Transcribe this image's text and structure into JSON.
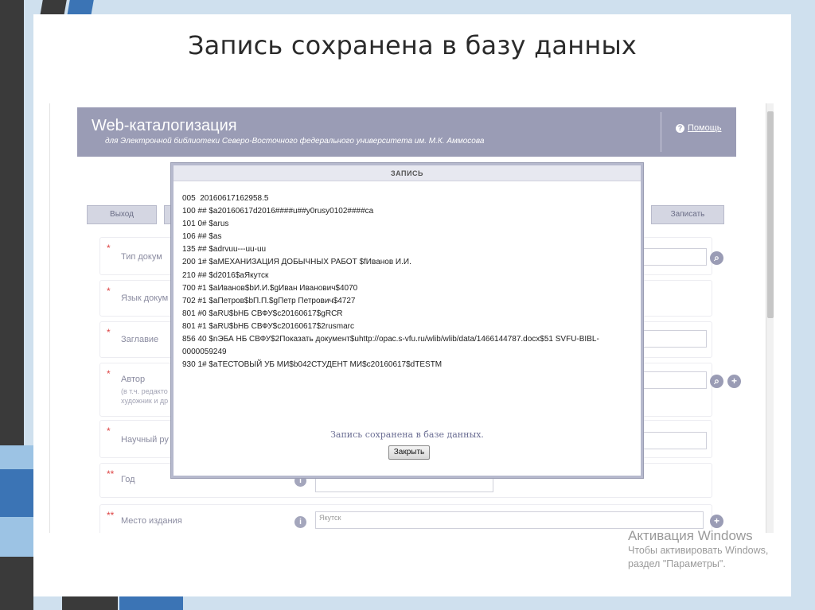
{
  "slide": {
    "title": "Запись сохранена в базу данных"
  },
  "banner": {
    "title": "Web-каталогизация",
    "subtitle": "для Электронной библиотеки Северо-Восточного федерального университета им. М.К. Аммосова",
    "help_label": "Помощь"
  },
  "toolbar": {
    "exit_label": "Выход",
    "save_label": "Записать"
  },
  "form": {
    "fields": [
      {
        "label": "Тип докум",
        "required": "*"
      },
      {
        "label": "Язык докум",
        "required": "*"
      },
      {
        "label": "Заглавие",
        "required": "*"
      },
      {
        "label": "Автор",
        "sub1": "(в т.ч. редакто",
        "sub2": "художник и др",
        "required": "*"
      },
      {
        "label": "Научный ру",
        "required": "*"
      },
      {
        "label": "Год",
        "required": "**"
      },
      {
        "label": "Место издания",
        "required": "**",
        "value": "Якутск"
      }
    ]
  },
  "dialog": {
    "title": "ЗАПИСЬ",
    "lines": [
      "005  20160617162958.5",
      "100 ## $a20160617d2016####u##y0rusy0102####ca",
      "101 0# $arus",
      "106 ## $as",
      "135 ## $adrvuu---uu-uu",
      "200 1# $aМЕХАНИЗАЦИЯ ДОБЫЧНЫХ РАБОТ $fИванов И.И.",
      "210 ## $d2016$aЯкутск",
      "700 #1 $aИванов$bИ.И.$gИван Иванович$4070",
      "702 #1 $aПетров$bП.П.$gПетр Петрович$4727",
      "801 #0 $aRU$bНБ СВФУ$c20160617$gRCR",
      "801 #1 $aRU$bНБ СВФУ$c20160617$2rusmarc",
      "856 40 $nЭБА НБ СВФУ$2Показать документ$uhttp://opac.s-vfu.ru/wlib/wlib/data/1466144787.docx$51 SVFU-BIBL-0000059249",
      "930 1# $aТЕСТОВЫЙ УБ МИ$b042СТУДЕНТ МИ$c20160617$dTESTM"
    ],
    "saved_message": "Запись сохранена в базе данных.",
    "close_label": "Закрыть"
  },
  "windows_activation": {
    "title": "Активация Windows",
    "line1": "Чтобы активировать Windows,",
    "line2": "раздел \"Параметры\"."
  }
}
